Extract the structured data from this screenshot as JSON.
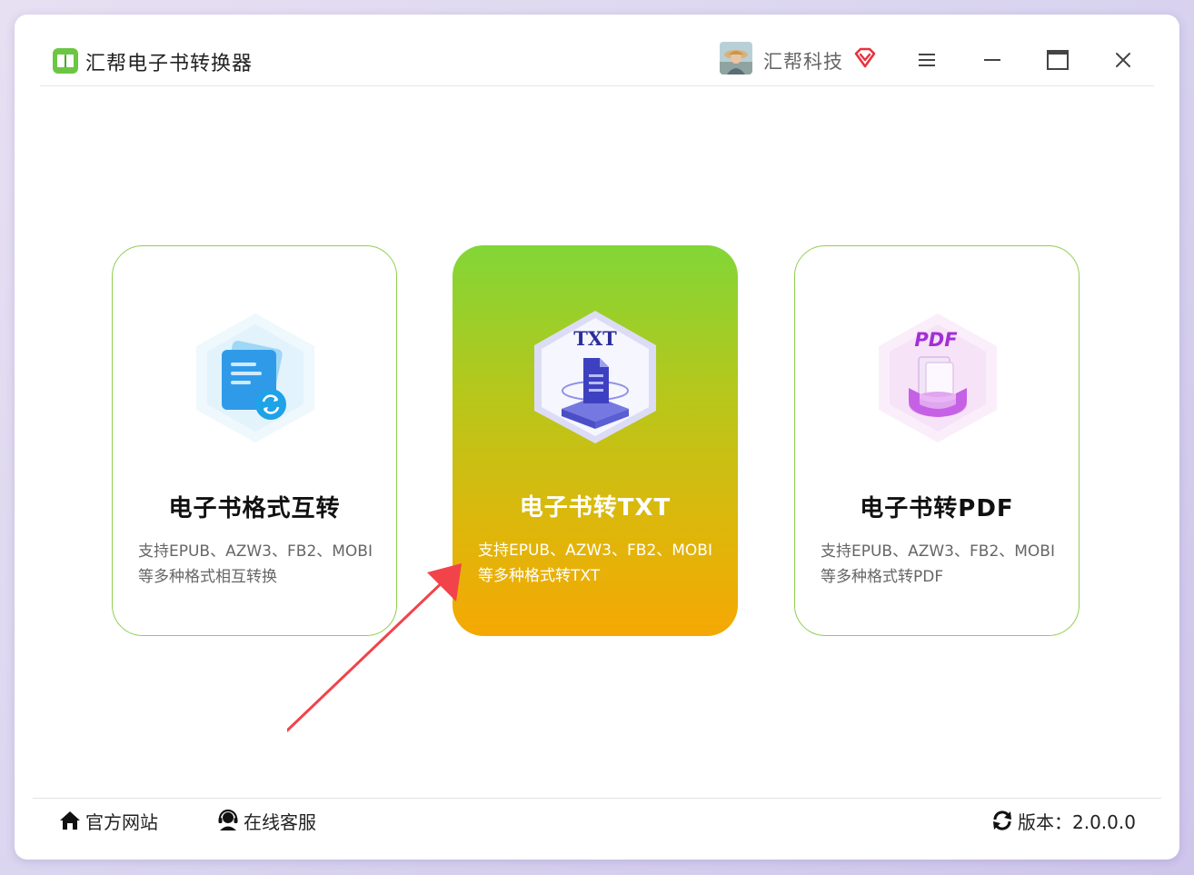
{
  "app": {
    "title": "汇帮电子书转换器"
  },
  "user": {
    "name": "汇帮科技"
  },
  "cards": [
    {
      "title": "电子书格式互转",
      "desc_line1": "支持EPUB、AZW3、FB2、MOBI",
      "desc_line2": "等多种格式相互转换"
    },
    {
      "title": "电子书转TXT",
      "icon_label": "TXT",
      "desc_line1": "支持EPUB、AZW3、FB2、MOBI",
      "desc_line2": "等多种格式转TXT"
    },
    {
      "title": "电子书转PDF",
      "icon_label": "PDF",
      "desc_line1": "支持EPUB、AZW3、FB2、MOBI",
      "desc_line2": "等多种格式转PDF"
    }
  ],
  "footer": {
    "website_label": "官方网站",
    "service_label": "在线客服",
    "version_label": "版本：2.0.0.0"
  },
  "icons": {
    "app_logo": "book-icon",
    "vip": "diamond-icon",
    "menu": "hamburger-icon",
    "minimize": "minimize-icon",
    "maximize": "maximize-icon",
    "close": "close-icon",
    "website": "home-icon",
    "service": "headset-icon",
    "version": "refresh-icon"
  },
  "colors": {
    "brand_green": "#6cc644",
    "card_border": "#8fce4f",
    "active_gradient_top": "#82d637",
    "active_gradient_bottom": "#f5a803",
    "vip_red": "#e8323c",
    "annotation_arrow": "#f2434b"
  }
}
